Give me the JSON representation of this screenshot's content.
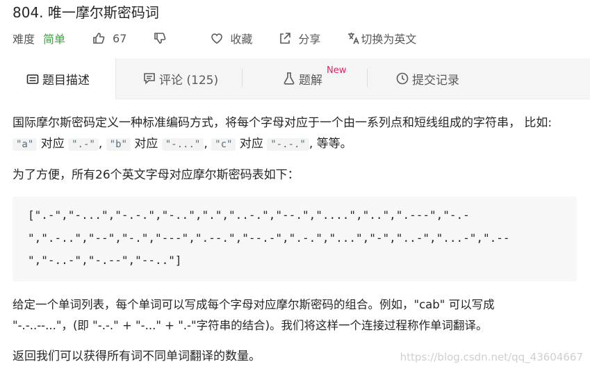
{
  "problem": {
    "title": "804. 唯一摩尔斯密码词"
  },
  "meta": {
    "difficulty_label": "难度",
    "difficulty_value": "简单",
    "likes": "67",
    "favorite_label": "收藏",
    "share_label": "分享",
    "switch_label": "切换为英文"
  },
  "tabs": {
    "description": "题目描述",
    "comments": "评论 (125)",
    "solutions": "题解",
    "solutions_badge": "New",
    "submissions": "提交记录"
  },
  "content": {
    "p1_a": "国际摩尔斯密码定义一种标准编码方式，将每个字母对应于一个由一系列点和短线组成的字符串， 比如: ",
    "code_a": "\"a\"",
    "p1_b": " 对应 ",
    "code_a_val": "\".-\"",
    "p1_c": ", ",
    "code_b": "\"b\"",
    "p1_d": " 对应 ",
    "code_b_val": "\"-...\"",
    "p1_e": ", ",
    "code_c": "\"c\"",
    "p1_f": " 对应 ",
    "code_c_val": "\"-.-.\"",
    "p1_g": ", 等等。",
    "p2": "为了方便，所有26个英文字母对应摩尔斯密码表如下：",
    "code_line1": "[\".-\",\"-...\",\"-.-.\",\"-..\",\".\",\"..-.\",\"--.\",\"....\",\"..\",\".---\",\"-.-",
    "code_line2": "\",\".-..\",\"--\",\"-.\",\"---\",\".--.\",\"--.-\",\".-.\",\"...\",\"-\",\"..-\",\"...-\",\".--",
    "code_line3": "\",\"-..-\",\"-.--\",\"--..\"]",
    "p3_line1": "给定一个单词列表，每个单词可以写成每个字母对应摩尔斯密码的组合。例如，\"cab\" 可以写成",
    "p3_line2": "\"-.-..--...\"，(即 \"-.-.\" + \"-...\" + \".-\"字符串的结合)。我们将这样一个连接过程称作单词翻译。",
    "p4": "返回我们可以获得所有词不同单词翻译的数量。"
  },
  "watermark": "https://blog.csdn.net/qq_43604667"
}
